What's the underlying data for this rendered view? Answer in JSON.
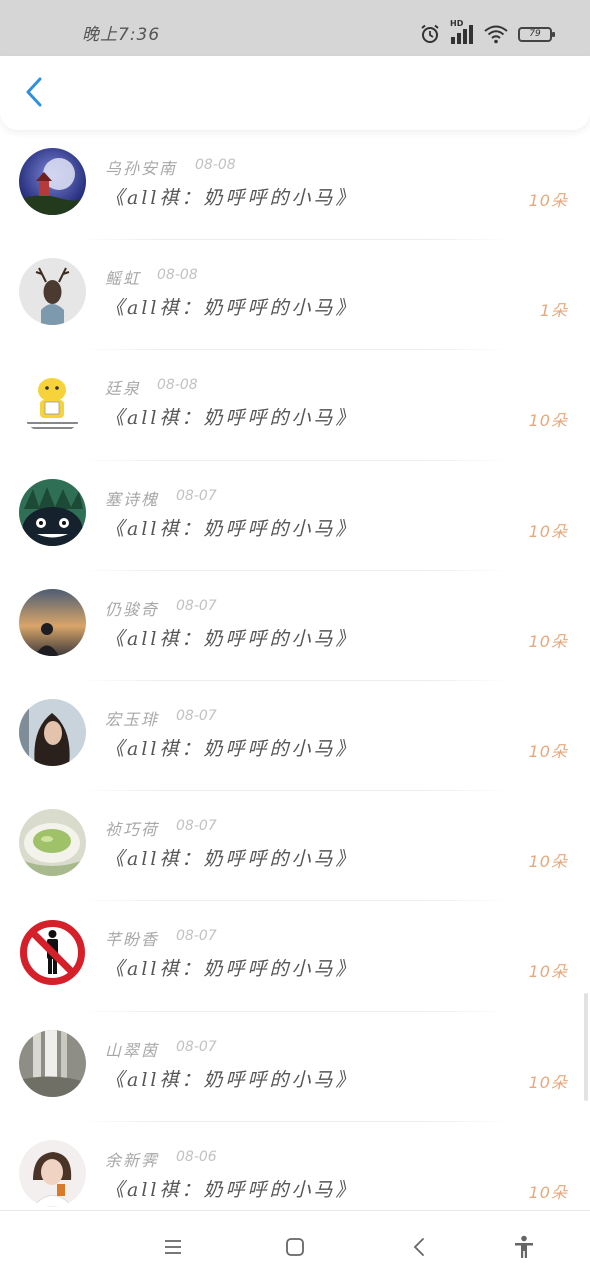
{
  "status_bar": {
    "time": "晚上7:36",
    "network_label": "HD",
    "battery_level": "79"
  },
  "colors": {
    "accent_blue": "#2f8fe0",
    "amount_orange": "#e7a87d",
    "status_bar_bg": "#d6d6d6"
  },
  "header": {
    "back_icon": "chevron-left-icon"
  },
  "list": {
    "items": [
      {
        "name": "乌孙安南",
        "date": "08-08",
        "content": "《all祺：奶呼呼的小马》",
        "amount": "10朵",
        "avatar": "moon-night-avatar"
      },
      {
        "name": "鳐虹",
        "date": "08-08",
        "content": "《all祺：奶呼呼的小马》",
        "amount": "1朵",
        "avatar": "deer-head-avatar"
      },
      {
        "name": "廷泉",
        "date": "08-08",
        "content": "《all祺：奶呼呼的小马》",
        "amount": "10朵",
        "avatar": "cartoon-chick-avatar"
      },
      {
        "name": "塞诗槐",
        "date": "08-07",
        "content": "《all祺：奶呼呼的小马》",
        "amount": "10朵",
        "avatar": "totoro-avatar"
      },
      {
        "name": "仍骏奇",
        "date": "08-07",
        "content": "《all祺：奶呼呼的小马》",
        "amount": "10朵",
        "avatar": "sunset-silhouette-avatar"
      },
      {
        "name": "宏玉琲",
        "date": "08-07",
        "content": "《all祺：奶呼呼的小马》",
        "amount": "10朵",
        "avatar": "girl-portrait-avatar"
      },
      {
        "name": "祯巧荷",
        "date": "08-07",
        "content": "《all祺：奶呼呼的小马》",
        "amount": "10朵",
        "avatar": "tea-cup-avatar"
      },
      {
        "name": "芊盼香",
        "date": "08-07",
        "content": "《all祺：奶呼呼的小马》",
        "amount": "10朵",
        "avatar": "no-entry-sign-avatar"
      },
      {
        "name": "山翠茵",
        "date": "08-07",
        "content": "《all祺：奶呼呼的小马》",
        "amount": "10朵",
        "avatar": "waterfall-avatar"
      },
      {
        "name": "余新霁",
        "date": "08-06",
        "content": "《all祺：奶呼呼的小马》",
        "amount": "10朵",
        "avatar": "girl-with-phone-avatar"
      }
    ]
  },
  "nav_bar": {
    "buttons": [
      "menu-icon",
      "home-icon",
      "back-icon",
      "accessibility-icon"
    ]
  }
}
